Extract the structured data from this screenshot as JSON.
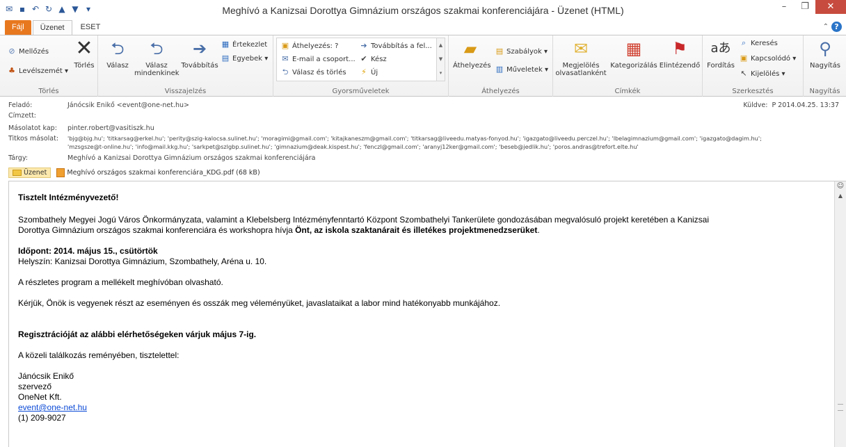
{
  "window": {
    "title": "Meghívó a Kanizsai Dorottya Gimnázium országos szakmai konferenciájára  -  Üzenet (HTML)"
  },
  "tabs": [
    {
      "label": "Fájl"
    },
    {
      "label": "Üzenet"
    },
    {
      "label": "ESET"
    }
  ],
  "ribbon": {
    "torles": {
      "group_label": "Törlés",
      "ignore_label": "Mellőzés",
      "junk_label": "Levélszemét ▾",
      "delete_label": "Törlés"
    },
    "valasz": {
      "group_label": "Visszajelzés",
      "reply_label": "Válasz",
      "reply_all_label": "Válasz mindenkinek",
      "forward_label": "Továbbítás",
      "meeting_label": "Értekezlet",
      "more_label": "Egyebek ▾"
    },
    "quicksteps": {
      "group_label": "Gyorsműveletek",
      "items": [
        {
          "label": "Áthelyezés: ?"
        },
        {
          "label": "Továbbítás a fel..."
        },
        {
          "label": "E-mail a csoport..."
        },
        {
          "label": "Kész"
        },
        {
          "label": "Válasz és törlés"
        },
        {
          "label": "Új"
        }
      ]
    },
    "athelyezes": {
      "group_label": "Áthelyezés",
      "move_label": "Áthelyezés",
      "rules_label": "Szabályok ▾",
      "actions_label": "Műveletek ▾"
    },
    "cimkek": {
      "group_label": "Címkék",
      "mark_read_label": "Megjelölés olvasatlanként",
      "categorize_label": "Kategorizálás",
      "followup_label": "Elintézendő"
    },
    "szerkesztes": {
      "group_label": "Szerkesztés",
      "translate_label": "Fordítás",
      "find_label": "Keresés",
      "related_label": "Kapcsolódó ▾",
      "select_label": "Kijelölés ▾"
    },
    "nagyitas": {
      "group_label": "Nagyítás",
      "zoom_label": "Nagyítás"
    }
  },
  "message": {
    "from_label": "Feladó:",
    "from_value": "Jánócsik Enikő <event@one-net.hu>",
    "to_label": "Címzett:",
    "to_value": "",
    "cc_label": "Másolatot kap:",
    "cc_value": "pinter.robert@vasitiszk.hu",
    "bcc_label": "Titkos másolat:",
    "bcc_value_line1": "'bjg@bjg.hu'; 'titkarsag@erkel.hu'; 'perity@szig-kalocsa.sulinet.hu'; 'moragimi@gmail.com'; 'kitajkaneszm@gmail.com'; 'titkarsag@liveedu.matyas-fonyod.hu'; 'igazgato@liveedu.perczel.hu'; 'lbelagimnazium@gmail.com'; 'igazgato@dagim.hu';",
    "bcc_value_line2": "'mzsgsze@t-online.hu'; 'info@mail.kkg.hu'; 'sarkpet@szlgbp.sulinet.hu'; 'gimnazium@deak.kispest.hu'; 'fenczl@gmail.com'; 'aranyj12ker@gmail.com'; 'beseb@jedlik.hu'; 'poros.andras@trefort.elte.hu'",
    "subject_label": "Tárgy:",
    "subject_value": "Meghívó a Kanizsai Dorottya Gimnázium országos szakmai konferenciájára",
    "sent_label": "Küldve:",
    "sent_value": "P 2014.04.25. 13:37"
  },
  "attachments": {
    "message_tab": "Üzenet",
    "file": "Meghívó országos szakmai konferenciára_KDG.pdf (68 kB)"
  },
  "body": {
    "greeting": "Tisztelt Intézményvezető!",
    "para1_line1": "Szombathely Megyei Jogú Város Önkormányzata, valamint a Klebelsberg Intézményfenntartó Központ Szombathelyi Tankerülete gondozásában megvalósuló projekt keretében a Kanizsai",
    "para1_line2_plain": "Dorottya Gimnázium országos szakmai konferenciára és workshopra hívja ",
    "para1_line2_bold": "Önt, az iskola szaktanárait és illetékes projektmenedzserüket",
    "para1_line2_end": ".",
    "date_line": "Időpont: 2014. május 15., csütörtök",
    "venue_line": "Helyszín: Kanizsai Dorottya Gimnázium, Szombathely, Aréna u. 10.",
    "program_line": "A részletes program a mellékelt meghívóban olvasható.",
    "request_line": "Kérjük, Önök is vegyenek részt az eseményen és osszák meg véleményüket, javaslataikat a labor mind hatékonyabb munkájához.",
    "registration_line": "Regisztrációját az alábbi elérhetőségeken várjuk május 7-ig.",
    "closing_line": "A közeli találkozás reményében, tisztelettel:",
    "sig_name": "Jánócsik Enikő",
    "sig_role": "szervező",
    "sig_company": "OneNet Kft.",
    "sig_email": "event@one-net.hu",
    "sig_phone": "(1) 209-9027"
  },
  "colors": {
    "file_tab": "#e8781f",
    "close_button": "#c74b3e",
    "link": "#0b4ad6"
  }
}
